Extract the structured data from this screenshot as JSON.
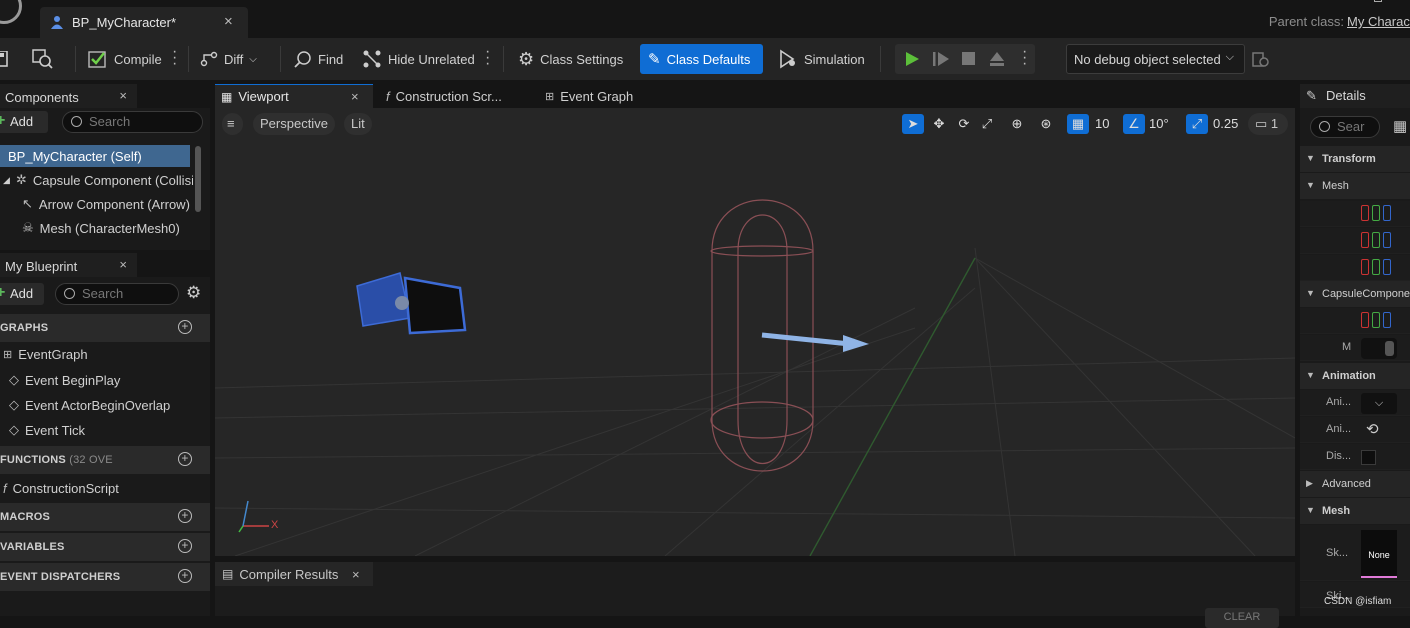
{
  "window": {
    "tab_title": "BP_MyCharacter*",
    "parent_class_label": "Parent class:",
    "parent_class_value": "My Charact"
  },
  "toolbar": {
    "compile": "Compile",
    "diff": "Diff",
    "find": "Find",
    "hide_unrelated": "Hide Unrelated",
    "class_settings": "Class Settings",
    "class_defaults": "Class Defaults",
    "simulation": "Simulation",
    "debug_object": "No debug object selected"
  },
  "components": {
    "title": "Components",
    "add": "Add",
    "search_placeholder": "Search",
    "items": [
      "BP_MyCharacter (Self)",
      "Capsule Component (Collisi",
      "Arrow Component (Arrow)",
      "Mesh (CharacterMesh0)"
    ]
  },
  "my_blueprint": {
    "title": "My Blueprint",
    "add": "Add",
    "search_placeholder": "Search",
    "graphs_label": "GRAPHS",
    "graphs": [
      "EventGraph",
      "Event BeginPlay",
      "Event ActorBeginOverlap",
      "Event Tick"
    ],
    "functions_label": "FUNCTIONS",
    "functions_count": "(32 OVE",
    "functions": [
      "ConstructionScript"
    ],
    "macros_label": "MACROS",
    "variables_label": "VARIABLES",
    "dispatchers_label": "EVENT DISPATCHERS"
  },
  "editor_tabs": {
    "viewport": "Viewport",
    "construction": "Construction Scr...",
    "event_graph": "Event Graph"
  },
  "viewport": {
    "perspective": "Perspective",
    "lit": "Lit",
    "grid_snap": "10",
    "rotation_snap": "10°",
    "scale_snap": "0.25",
    "camera_speed": "1",
    "axis_x": "X"
  },
  "compiler_results": {
    "title": "Compiler Results",
    "clear": "CLEAR"
  },
  "details": {
    "title": "Details",
    "search_placeholder": "Sear",
    "sections": {
      "transform": "Transform",
      "mesh": "Mesh",
      "capsule": "CapsuleCompone",
      "animation": "Animation",
      "advanced": "Advanced",
      "mesh2": "Mesh"
    },
    "rows": {
      "m": "M",
      "ani1": "Ani...",
      "ani2": "Ani...",
      "dis": "Dis...",
      "sk": "Sk...",
      "ski": "Ski...",
      "none": "None"
    }
  },
  "watermark": "CSDN @isfiam"
}
